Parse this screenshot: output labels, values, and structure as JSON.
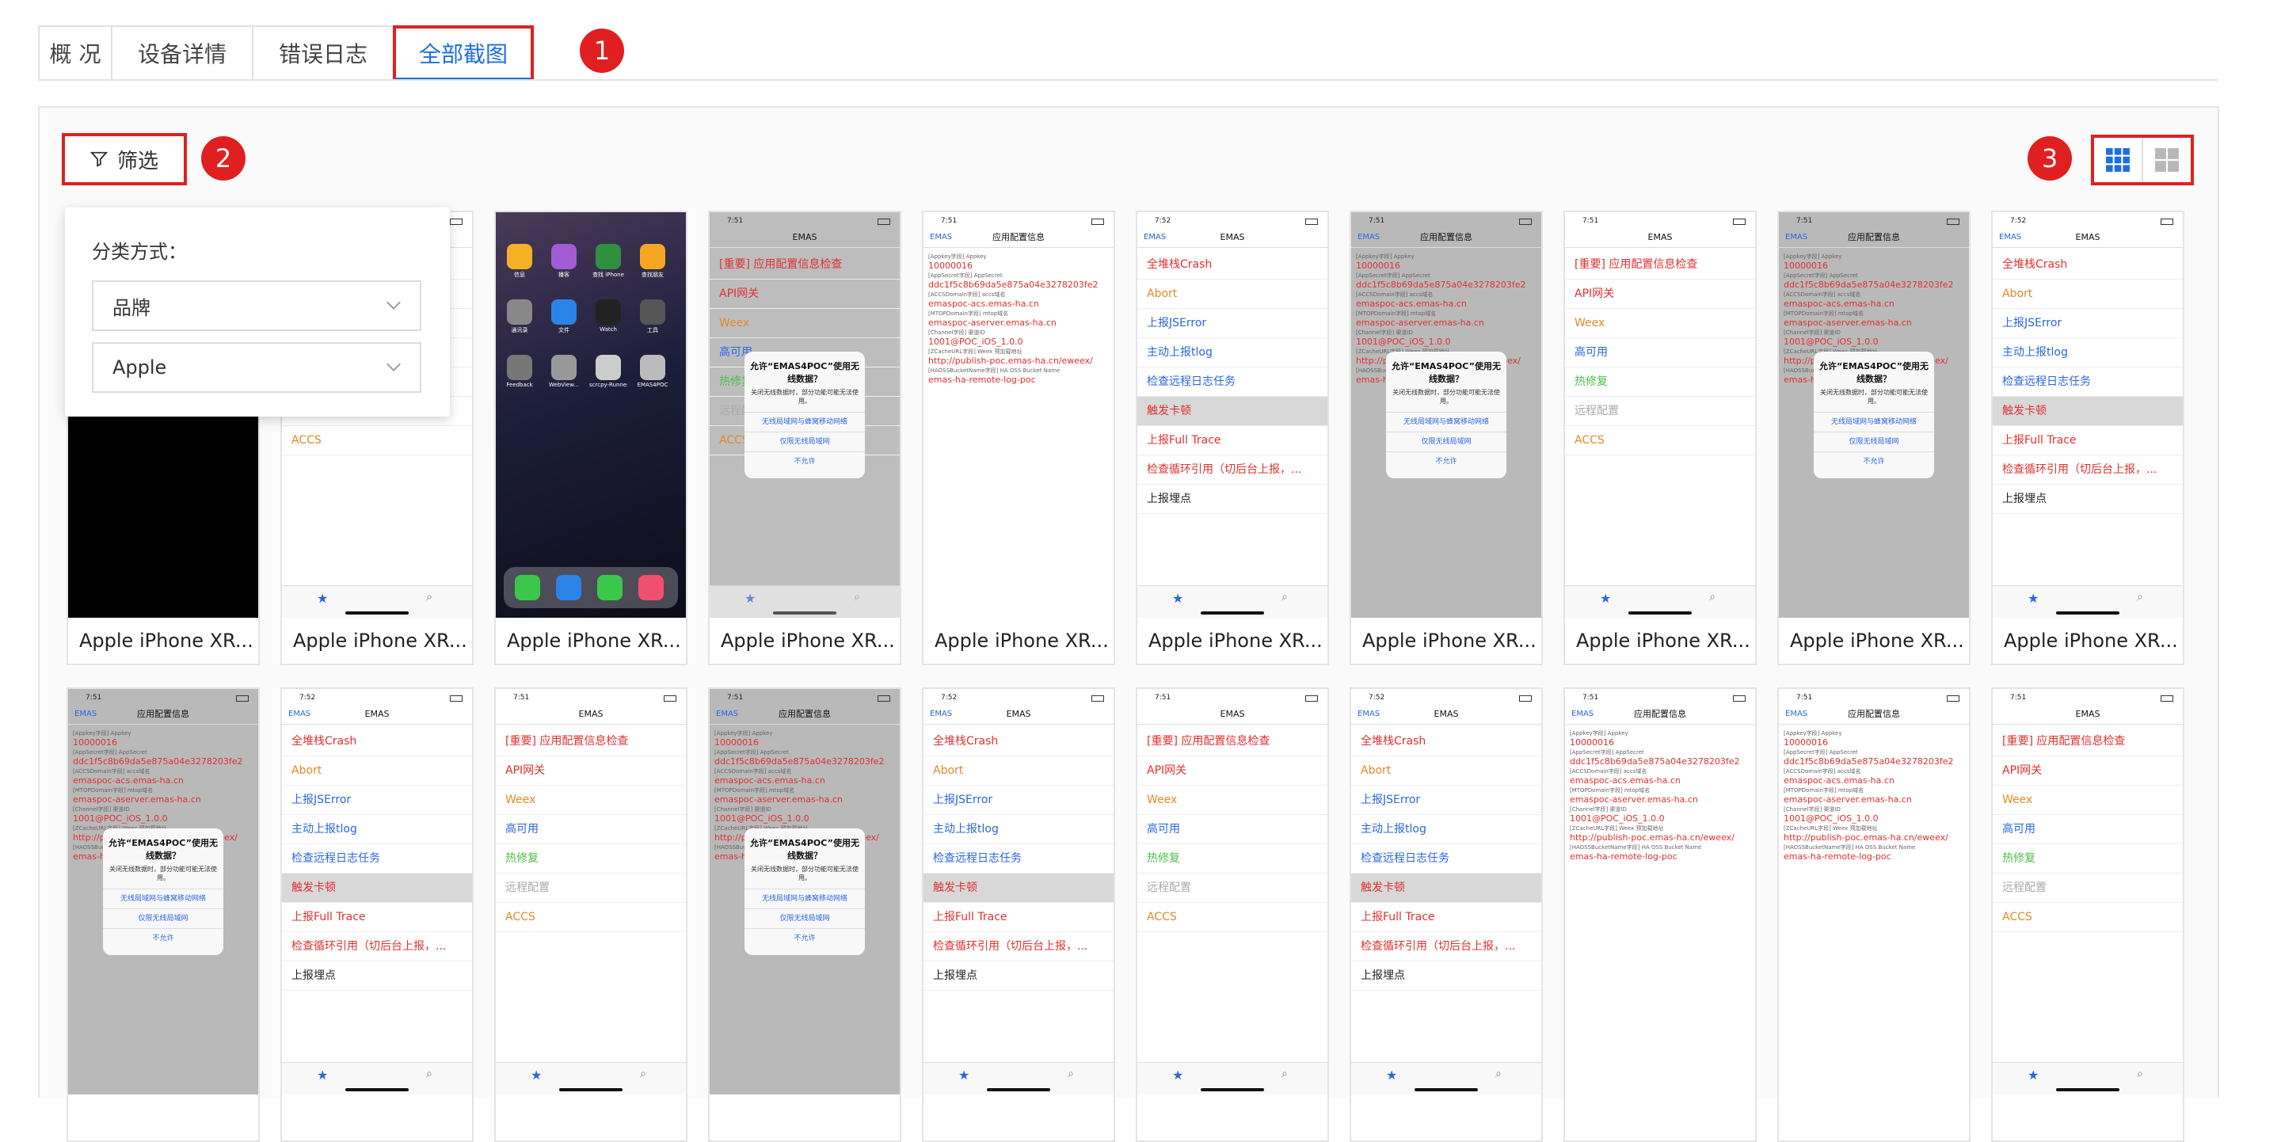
{
  "tabs": [
    {
      "label": "概 况"
    },
    {
      "label": "设备详情"
    },
    {
      "label": "错误日志"
    },
    {
      "label": "全部截图"
    }
  ],
  "markers": [
    "1",
    "2",
    "3"
  ],
  "filter": {
    "button_label": "筛选",
    "popover_title": "分类方式：",
    "category_select": "品牌",
    "value_select": "Apple"
  },
  "cards_row1": [
    "Apple iPhone XR...",
    "Apple iPhone XR...",
    "Apple iPhone XR...",
    "Apple iPhone XR...",
    "Apple iPhone XR...",
    "Apple iPhone XR...",
    "Apple iPhone XR...",
    "Apple iPhone XR...",
    "Apple iPhone XR...",
    "Apple iPhone XR..."
  ],
  "screen": {
    "time1": "7:51",
    "time2": "7:52",
    "title_emas": "EMAS",
    "title_config": "应用配置信息",
    "back": "EMAS",
    "menu_a": [
      "[重要] 应用配置信息检查",
      "API网关",
      "Weex",
      "高可用",
      "热修复",
      "远程配置",
      "ACCS"
    ],
    "menu_b": [
      "全堆栈Crash",
      "Abort",
      "上报JSError",
      "主动上报tlog",
      "检查远程日志任务",
      "触发卡顿",
      "上报Full Trace",
      "检查循环引用（切后台上报，...",
      "上报埋点"
    ],
    "cfg_keys": [
      "[Appkey字段] Appkey",
      "[AppSecret字段] AppSecret",
      "[ACCSDomain字段] accs域名",
      "[MTOPDomain字段] mtop域名",
      "[Channel字段] 渠道ID",
      "[ZCacheURL字段] Weex 预加载地址",
      "[HAOSSBucketName字段] HA OSS Bucket Name"
    ],
    "cfg_vals": [
      "10000016",
      "ddc1f5c8b69da5e875a04e3278203fe2",
      "emaspoc-acs.emas-ha.cn",
      "emaspoc-aserver.emas-ha.cn",
      "1001@POC_iOS_1.0.0",
      "http://publish-poc.emas-ha.cn/eweex/",
      "emas-ha-remote-log-poc"
    ],
    "alert_title": "允许“EMAS4POC”使用无线数据？",
    "alert_body": "关闭无线数据时，部分功能可能无法使用。",
    "alert_opt1": "无线局域网与蜂窝移动网络",
    "alert_opt2": "仅限无线局域网",
    "alert_opt3": "不允许",
    "tab_fav": "Favorites",
    "tab_search": "Search",
    "apps": [
      "信息",
      "播客",
      "查找 iPhone",
      "查找朋友",
      "通讯录",
      "文件",
      "Watch",
      "工具",
      "Feedback",
      "WebView...",
      "scrcpy-Runner",
      "EMAS4POC"
    ]
  },
  "colors": {
    "accent": "#1d6fe0",
    "marker": "#e02020",
    "menu_red": "#e03030",
    "menu_blue": "#2a66e0",
    "menu_orange": "#e08a2a",
    "menu_green": "#4cc04a"
  }
}
